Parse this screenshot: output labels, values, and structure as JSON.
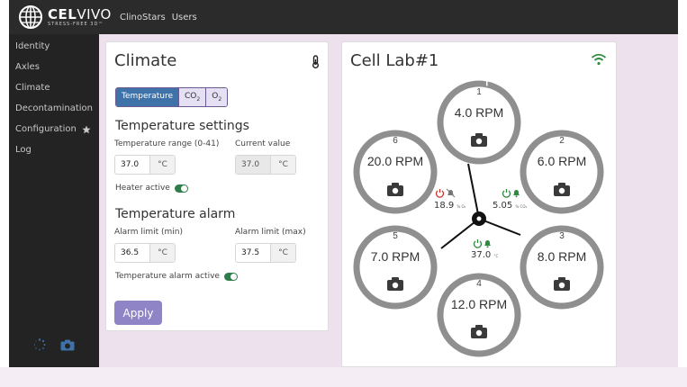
{
  "brand": {
    "name_bold": "CEL",
    "name_light": "VIVO",
    "tagline": "STRESS-FREE 3D™"
  },
  "topnav": [
    "ClinoStars",
    "Users"
  ],
  "sidebar": {
    "items": [
      {
        "label": "Identity"
      },
      {
        "label": "Axles"
      },
      {
        "label": "Climate"
      },
      {
        "label": "Decontamination"
      },
      {
        "label": "Configuration"
      },
      {
        "label": "Log"
      }
    ],
    "configuration_icon": "star-icon",
    "bottom_icons": [
      "spinner-icon",
      "camera-icon"
    ]
  },
  "climate": {
    "title": "Climate",
    "title_icon": "thermometer-icon",
    "tabs": [
      {
        "label": "Temperature",
        "active": true
      },
      {
        "label": "CO",
        "sub": "2",
        "active": false
      },
      {
        "label": "O",
        "sub": "2",
        "active": false
      }
    ],
    "temperature_settings": {
      "title": "Temperature settings",
      "range_label": "Temperature range (0-41)",
      "range_value": "37.0",
      "range_unit": "°C",
      "current_label": "Current value",
      "current_value": "37.0",
      "current_unit": "°C",
      "heater_label": "Heater active",
      "heater_on": true
    },
    "temperature_alarm": {
      "title": "Temperature alarm",
      "min_label": "Alarm limit (min)",
      "min_value": "36.5",
      "min_unit": "°C",
      "max_label": "Alarm limit (max)",
      "max_value": "37.5",
      "max_unit": "°C",
      "alarm_active_label": "Temperature alarm active",
      "alarm_active_on": true
    },
    "apply_label": "Apply"
  },
  "cell_lab": {
    "title": "Cell Lab#1",
    "status_icon": "wifi-icon",
    "rotors": [
      {
        "num": "1",
        "rpm": "4.0 RPM"
      },
      {
        "num": "2",
        "rpm": "6.0 RPM"
      },
      {
        "num": "3",
        "rpm": "8.0 RPM"
      },
      {
        "num": "4",
        "rpm": "12.0 RPM"
      },
      {
        "num": "5",
        "rpm": "7.0 RPM"
      },
      {
        "num": "6",
        "rpm": "20.0 RPM"
      }
    ],
    "sensors": {
      "o2": {
        "value": "18.9",
        "unit": "% O₂",
        "status": "off-alarm-muted"
      },
      "co2": {
        "value": "5.05",
        "unit": "% CO₂",
        "status": "on-alarm"
      },
      "temp": {
        "value": "37.0",
        "unit": "°C",
        "status": "on-alarm"
      }
    },
    "colors": {
      "ring": "#8f8f8f",
      "on": "#2e8b3e",
      "off": "#d0342c",
      "accent": "#3e72a8",
      "button": "#8f85c6"
    }
  }
}
